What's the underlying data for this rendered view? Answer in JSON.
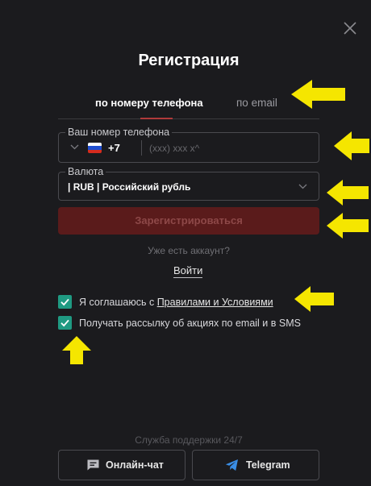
{
  "modal": {
    "title": "Регистрация"
  },
  "tabs": [
    {
      "label": "по номеру телефона"
    },
    {
      "label": "по email"
    }
  ],
  "phone": {
    "label": "Ваш номер телефона",
    "country_code": "+7",
    "placeholder": "(xxx) xxx x^"
  },
  "currency": {
    "label": "Валюта",
    "value": "| RUB | Российский рубль"
  },
  "register": {
    "label": "Зарегистрироваться"
  },
  "account": {
    "question": "Уже есть аккаунт?",
    "login_label": "Войти"
  },
  "consents": {
    "rules_prefix": "Я соглашаюсь с ",
    "rules_link": "Правилами и Условиями",
    "newsletter": "Получать рассылку об акциях по email и в SMS",
    "rules_checked": true,
    "newsletter_checked": true
  },
  "support": {
    "text": "Служба поддержки 24/7",
    "chat_label": "Онлайн-чат",
    "telegram_label": "Telegram"
  },
  "icons": {
    "close": "close-icon",
    "chat": "chat-icon",
    "telegram": "telegram-icon",
    "flag": "russia-flag-icon",
    "chevron": "chevron-down-icon"
  },
  "colors": {
    "background": "#1b1b1e",
    "accent": "#5a1b1b",
    "checkbox": "#1f9a82",
    "annotation_arrow": "#f5e600"
  }
}
